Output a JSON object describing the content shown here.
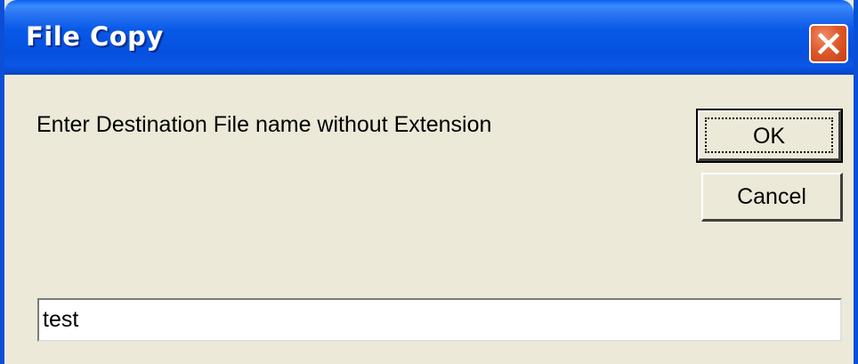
{
  "window": {
    "title": "File Copy",
    "close_icon": "close-icon",
    "accent_color": "#0a4fd6",
    "close_button_color": "#e05a2b",
    "body_color": "#ece9d8"
  },
  "dialog": {
    "prompt": "Enter Destination File name without Extension",
    "ok_label": "OK",
    "cancel_label": "Cancel",
    "input_value": "test"
  }
}
